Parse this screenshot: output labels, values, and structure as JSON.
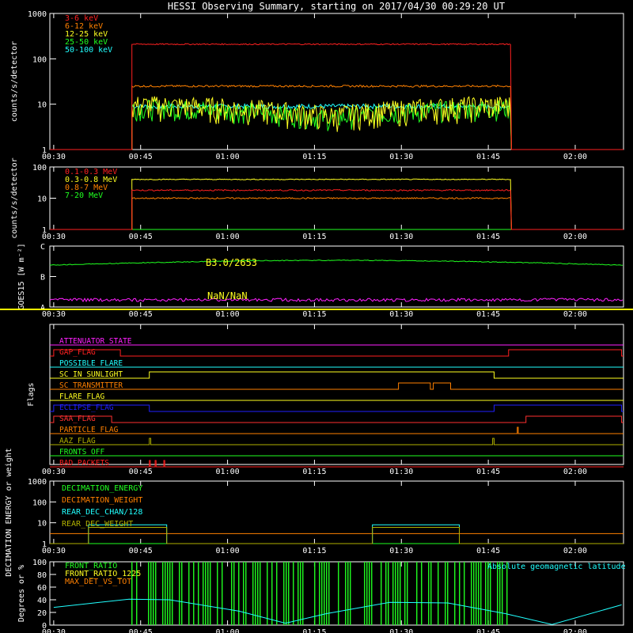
{
  "title": "HESSI Observing Summary, starting on 2017/04/30 00:29:20 UT",
  "x_ticks": [
    "00:30",
    "00:45",
    "01:00",
    "01:15",
    "01:30",
    "01:45",
    "02:00"
  ],
  "colors": {
    "background": "#000000",
    "axes": "#ffffff",
    "red": "#ff2020",
    "orange": "#ff8000",
    "yellow": "#ffff20",
    "green": "#20ff20",
    "cyan": "#20ffff",
    "magenta": "#ff20ff",
    "blue": "#2020ff",
    "olive": "#b0b000",
    "saa_red": "#ff3030",
    "divider": "#ffff00"
  },
  "chart_data": [
    {
      "id": "low_energy",
      "type": "line",
      "ylabel": "counts/s/detector",
      "yscale": "log",
      "ylim": [
        1,
        1000
      ],
      "y_ticks": [
        "1",
        "10",
        "100",
        "1000"
      ],
      "legend_position": "top-left",
      "series": [
        {
          "name": "3-6 keV",
          "color": "#ff2020",
          "start": "00:43:30",
          "end": "01:49:00",
          "level": 210,
          "noise": 0.03,
          "base": 1
        },
        {
          "name": "6-12 keV",
          "color": "#ff8000",
          "start": "00:43:30",
          "end": "01:49:00",
          "level": 25,
          "noise": 0.05,
          "base": 1
        },
        {
          "name": "12-25 keV",
          "color": "#ffff20",
          "start": "00:43:30",
          "end": "01:49:00",
          "level": 8,
          "noise": 0.3,
          "base": 1
        },
        {
          "name": "25-50 keV",
          "color": "#20ff20",
          "start": "00:43:30",
          "end": "01:49:00",
          "level": 7,
          "noise": 0.25,
          "base": 1
        },
        {
          "name": "50-100 keV",
          "color": "#20ffff",
          "start": "00:43:30",
          "end": "01:49:00",
          "level": 9,
          "noise": 0.12,
          "base": 1
        }
      ]
    },
    {
      "id": "high_energy",
      "type": "line",
      "ylabel": "counts/s/detector",
      "yscale": "log",
      "ylim": [
        1,
        100
      ],
      "y_ticks": [
        "1",
        "10",
        "100"
      ],
      "legend_position": "top-left",
      "series": [
        {
          "name": "0.1-0.3 MeV",
          "color": "#ff2020",
          "start": "00:43:30",
          "end": "01:49:00",
          "level": 18,
          "noise": 0.05,
          "base": 1
        },
        {
          "name": "0.3-0.8 MeV",
          "color": "#ffff20",
          "start": "00:43:30",
          "end": "01:49:00",
          "level": 40,
          "noise": 0.03,
          "base": 1
        },
        {
          "name": "0.8-7 MeV",
          "color": "#ff8000",
          "start": "00:43:30",
          "end": "01:49:00",
          "level": 10,
          "noise": 0.05,
          "base": 1
        },
        {
          "name": "7-20 MeV",
          "color": "#20ff20",
          "start": "00:30:00",
          "end": "02:08:00",
          "level": 1,
          "noise": 0,
          "base": 1
        }
      ]
    },
    {
      "id": "goes",
      "type": "line",
      "ylabel": "GOES15 [W m⁻²]",
      "y_ticks": [
        "A",
        "B",
        "C"
      ],
      "annotations": [
        "B3.0/2653",
        "NaN/NaN"
      ],
      "series": [
        {
          "color": "#20ff20",
          "level": "B7"
        },
        {
          "color": "#ff20ff",
          "level": "A1.5"
        }
      ]
    },
    {
      "id": "flags",
      "type": "line",
      "ylabel": "Flags",
      "series": [
        {
          "name": "ATTENUATOR_STATE",
          "color": "#ff20ff",
          "on": []
        },
        {
          "name": "GAP_FLAG",
          "color": "#ff2020",
          "on": [
            [
              "00:30:00",
              "00:41:30"
            ],
            [
              "01:48:30",
              "02:08:00"
            ]
          ]
        },
        {
          "name": "POSSIBLE_FLARE",
          "color": "#20ffff",
          "on": []
        },
        {
          "name": "SC_IN_SUNLIGHT",
          "color": "#ffff20",
          "on": [
            [
              "00:46:30",
              "01:46:00"
            ]
          ]
        },
        {
          "name": "SC_TRANSMITTER",
          "color": "#ff8000",
          "on": [
            [
              "01:29:30",
              "01:35:00"
            ],
            [
              "01:35:30",
              "01:38:30"
            ]
          ]
        },
        {
          "name": "FLARE_FLAG",
          "color": "#ffff20",
          "on": []
        },
        {
          "name": "ECLIPSE_FLAG",
          "color": "#2020ff",
          "on": [
            [
              "00:30:00",
              "00:46:30"
            ],
            [
              "01:46:00",
              "02:08:00"
            ]
          ]
        },
        {
          "name": "SAA_FLAG",
          "color": "#ff3030",
          "on": [
            [
              "00:30:00",
              "00:40:00"
            ],
            [
              "01:51:30",
              "02:08:00"
            ]
          ]
        },
        {
          "name": "PARTICLE_FLAG",
          "color": "#ff8000",
          "on": [
            [
              "01:50:00",
              "01:50:10"
            ]
          ]
        },
        {
          "name": "AAZ_FLAG",
          "color": "#b0b000",
          "on": [
            [
              "00:46:30",
              "00:46:45"
            ],
            [
              "01:45:45",
              "01:46:00"
            ]
          ]
        },
        {
          "name": "FRONTS_OFF",
          "color": "#20ff20",
          "on": []
        },
        {
          "name": "BAD_PACKETS",
          "color": "#ff2020",
          "on": [
            [
              "00:46:30",
              "00:46:40"
            ],
            [
              "00:47:30",
              "00:47:40"
            ],
            [
              "00:49:00",
              "00:49:10"
            ]
          ]
        }
      ]
    },
    {
      "id": "decimation",
      "type": "line",
      "ylabel": "DECIMATION ENERGY or weight",
      "yscale": "log",
      "ylim": [
        1,
        1000
      ],
      "y_ticks": [
        "1",
        "10",
        "100",
        "1000"
      ],
      "series": [
        {
          "name": "DECIMATION_ENERGY",
          "color": "#20ff20",
          "base": 1,
          "level": 1,
          "on": []
        },
        {
          "name": "DECIMATION_WEIGHT",
          "color": "#ff8000",
          "base": 3,
          "level": 3,
          "on": []
        },
        {
          "name": "REAR_DEC_CHAN/128",
          "color": "#20ffff",
          "base": 1,
          "level": 8,
          "on": [
            [
              "00:36:00",
              "00:49:30"
            ],
            [
              "01:25:00",
              "01:40:00"
            ]
          ]
        },
        {
          "name": "REAR_DEC_WEIGHT",
          "color": "#b0b000",
          "base": 1,
          "level": 6,
          "on": [
            [
              "00:36:00",
              "00:49:30"
            ],
            [
              "01:25:00",
              "01:40:00"
            ]
          ]
        }
      ]
    },
    {
      "id": "ratios",
      "type": "line",
      "ylabel": "Degrees or %",
      "ylim": [
        0,
        100
      ],
      "y_ticks": [
        "0",
        "20",
        "40",
        "60",
        "80",
        "100"
      ],
      "annotation": "Absolute geomagnetic latitude",
      "series": [
        {
          "name": "FRONT_RATIO",
          "color": "#20ff20",
          "on": [
            [
              "00:43:30",
              "01:49:00"
            ]
          ]
        },
        {
          "name": "FRONT_RATIO_1225",
          "color": "#ffff20",
          "on": []
        },
        {
          "name": "MAX_DET_VS_TOT",
          "color": "#ff8000",
          "on": []
        },
        {
          "name": "Absolute geomagnetic latitude",
          "color": "#20ffff",
          "points": [
            [
              "00:30:00",
              28
            ],
            [
              "00:43:00",
              41
            ],
            [
              "00:50:00",
              40
            ],
            [
              "01:02:00",
              22
            ],
            [
              "01:10:00",
              3
            ],
            [
              "01:17:00",
              18
            ],
            [
              "01:28:00",
              36
            ],
            [
              "01:38:00",
              35
            ],
            [
              "01:48:00",
              18
            ],
            [
              "01:56:00",
              1
            ],
            [
              "02:08:00",
              32
            ]
          ]
        }
      ]
    }
  ]
}
